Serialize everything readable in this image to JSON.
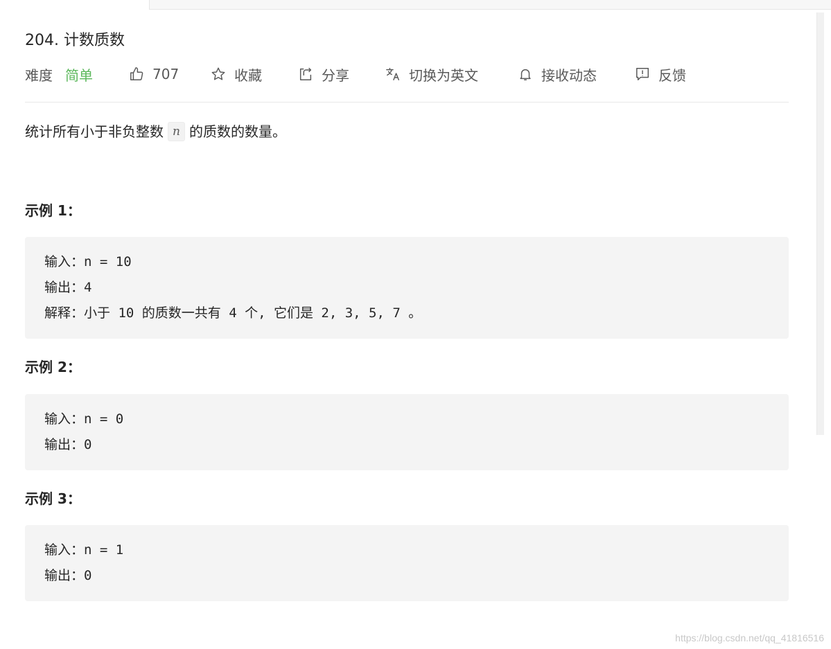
{
  "problem": {
    "title": "204. 计数质数",
    "difficulty_label": "难度",
    "difficulty_value": "简单",
    "likes": "707",
    "favorite_label": "收藏",
    "share_label": "分享",
    "switch_lang_label": "切换为英文",
    "subscribe_label": "接收动态",
    "feedback_label": "反馈",
    "description_before": "统计所有小于非负整数",
    "description_var": "n",
    "description_after": "的质数的数量。"
  },
  "examples": [
    {
      "title": "示例 1：",
      "input": "输入：n = 10",
      "output": "输出：4",
      "explanation": "解释：小于 10 的质数一共有 4 个, 它们是 2, 3, 5, 7 。"
    },
    {
      "title": "示例 2：",
      "input": "输入：n = 0",
      "output": "输出：0"
    },
    {
      "title": "示例 3：",
      "input": "输入：n = 1",
      "output": "输出：0"
    }
  ],
  "watermark": "https://blog.csdn.net/qq_41816516",
  "colors": {
    "difficulty_easy": "#5cb85c",
    "code_bg": "#f4f4f4"
  },
  "icons": [
    "thumbs-up-icon",
    "star-icon",
    "share-icon",
    "translate-icon",
    "bell-icon",
    "feedback-icon"
  ]
}
